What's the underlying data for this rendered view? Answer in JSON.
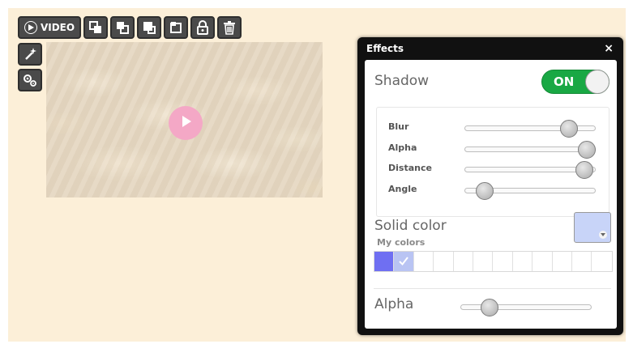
{
  "toolbar": {
    "video_label": "VIDEO",
    "buttons": [
      "send-backward-icon",
      "bring-forward-icon",
      "bring-to-front-icon",
      "send-to-back-icon",
      "lock-icon",
      "trash-icon"
    ]
  },
  "side_tools": [
    "magic-wand-icon",
    "settings-gears-icon"
  ],
  "video": {
    "play_color": "#f4a8c6"
  },
  "effects_panel": {
    "title": "Effects",
    "close_label": "×",
    "shadow": {
      "label": "Shadow",
      "toggle_label": "ON",
      "enabled": true,
      "sliders": [
        {
          "label": "Blur",
          "value": 0.8
        },
        {
          "label": "Alpha",
          "value": 0.94
        },
        {
          "label": "Distance",
          "value": 0.92
        },
        {
          "label": "Angle",
          "value": 0.15
        }
      ]
    },
    "solid_color": {
      "label": "Solid color",
      "swatch_color": "#c8d4f8",
      "my_colors_label": "My colors",
      "palette": [
        {
          "color": "#6f6ff2",
          "selected": false
        },
        {
          "color": "#b9c4f3",
          "selected": true
        },
        {
          "color": "#ffffff",
          "selected": false
        },
        {
          "color": "#ffffff",
          "selected": false
        },
        {
          "color": "#ffffff",
          "selected": false
        },
        {
          "color": "#ffffff",
          "selected": false
        },
        {
          "color": "#ffffff",
          "selected": false
        },
        {
          "color": "#ffffff",
          "selected": false
        },
        {
          "color": "#ffffff",
          "selected": false
        },
        {
          "color": "#ffffff",
          "selected": false
        },
        {
          "color": "#ffffff",
          "selected": false
        },
        {
          "color": "#ffffff",
          "selected": false
        }
      ]
    },
    "alpha": {
      "label": "Alpha",
      "value": 0.22
    }
  }
}
